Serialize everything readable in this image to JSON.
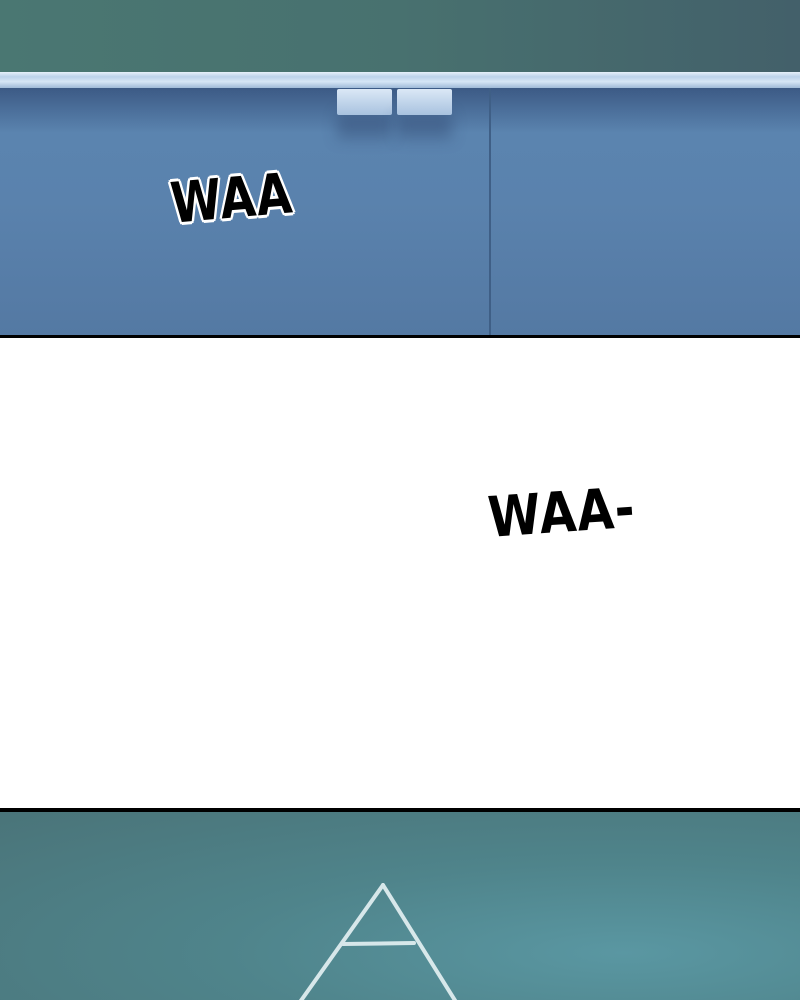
{
  "panels": [
    {
      "sfx": "WAA"
    },
    {
      "sfx": "WAA-"
    },
    {}
  ],
  "colors": {
    "chalkboard": "#4a7772",
    "wall": "#5d88b4",
    "chalk": "#e8f4f6",
    "border": "#000000"
  }
}
